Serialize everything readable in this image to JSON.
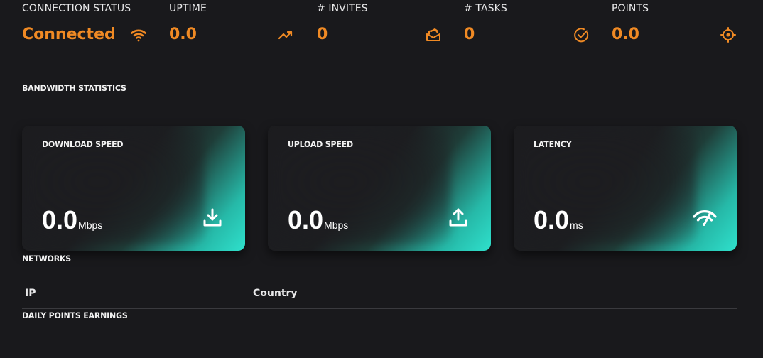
{
  "stats": {
    "connection": {
      "label": "CONNECTION STATUS",
      "value": "Connected",
      "icon": "wifi-icon"
    },
    "uptime": {
      "label": "UPTIME",
      "value": "0.0",
      "icon": "trending-up-icon"
    },
    "invites": {
      "label": "# INVITES",
      "value": "0",
      "icon": "envelope-stack-icon"
    },
    "tasks": {
      "label": "# TASKS",
      "value": "0",
      "icon": "check-circle-icon"
    },
    "points": {
      "label": "POINTS",
      "value": "0.0",
      "icon": "target-icon"
    }
  },
  "sections": {
    "bandwidth": "BANDWIDTH STATISTICS",
    "networks": "NETWORKS",
    "daily": "DAILY POINTS EARNINGS"
  },
  "cards": [
    {
      "title": "DOWNLOAD SPEED",
      "value": "0.0",
      "unit": "Mbps",
      "icon": "download-icon"
    },
    {
      "title": "UPLOAD SPEED",
      "value": "0.0",
      "unit": "Mbps",
      "icon": "upload-icon"
    },
    {
      "title": "LATENCY",
      "value": "0.0",
      "unit": "ms",
      "icon": "wifi-speed-icon"
    }
  ],
  "networks_table": {
    "columns": [
      "IP",
      "Country"
    ]
  },
  "colors": {
    "accent": "#f08a24",
    "background": "#19191c",
    "card_gradient_end": "#2fe0cc"
  }
}
